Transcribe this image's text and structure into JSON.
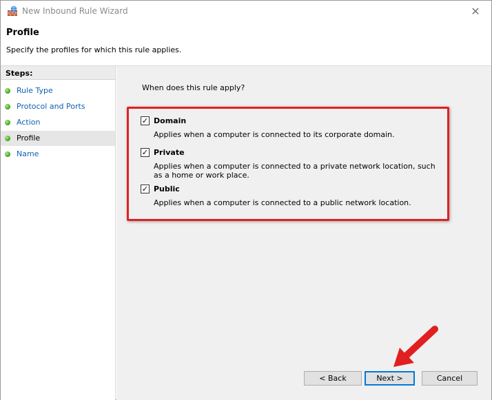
{
  "window": {
    "title": "New Inbound Rule Wizard",
    "close_glyph": "✕"
  },
  "header": {
    "title": "Profile",
    "subtitle": "Specify the profiles for which this rule applies."
  },
  "steps": {
    "heading": "Steps:",
    "items": [
      {
        "label": "Rule Type"
      },
      {
        "label": "Protocol and Ports"
      },
      {
        "label": "Action"
      },
      {
        "label": "Profile"
      },
      {
        "label": "Name"
      }
    ]
  },
  "main": {
    "question": "When does this rule apply?",
    "profiles": [
      {
        "label": "Domain",
        "checked": true,
        "description": "Applies when a computer is connected to its corporate domain."
      },
      {
        "label": "Private",
        "checked": true,
        "description": "Applies when a computer is connected to a private network location, such as a home or work place."
      },
      {
        "label": "Public",
        "checked": true,
        "description": "Applies when a computer is connected to a public network location."
      }
    ],
    "check_glyph": "✓"
  },
  "buttons": {
    "back": "< Back",
    "next": "Next >",
    "cancel": "Cancel"
  },
  "colors": {
    "annotation_red": "#e02020",
    "link_blue": "#1060b0",
    "step_dot_green": "#3e9a1e",
    "content_bg": "#f0f0f0"
  }
}
